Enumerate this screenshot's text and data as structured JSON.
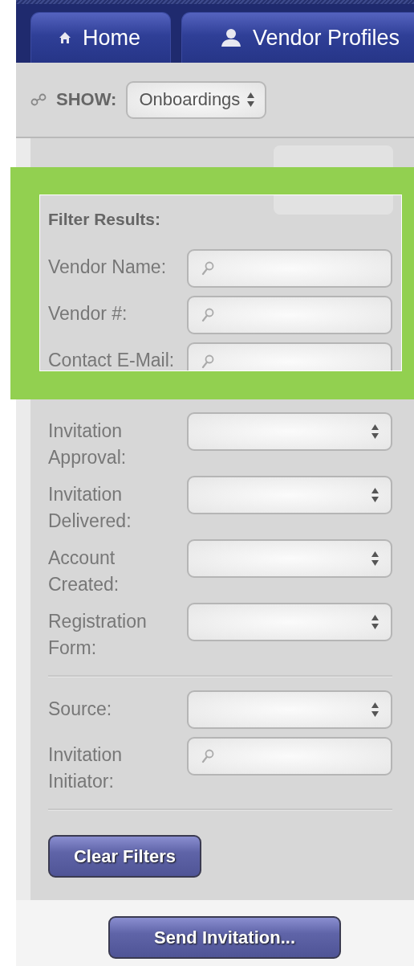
{
  "nav": {
    "tabs": [
      {
        "label": "Home",
        "selected": false
      },
      {
        "label": "Vendor Profiles",
        "selected": false
      }
    ]
  },
  "show": {
    "label": "SHOW:",
    "value": "Onboardings"
  },
  "filters": {
    "title": "Filter Results:",
    "groups": [
      [
        {
          "label": "Vendor Name:",
          "kind": "search"
        },
        {
          "label": "Vendor #:",
          "kind": "search"
        },
        {
          "label": "Contact E-Mail:",
          "kind": "search"
        }
      ],
      [
        {
          "label": "Invitation Approval:",
          "kind": "select"
        },
        {
          "label": "Invitation Delivered:",
          "kind": "select"
        },
        {
          "label": "Account Created:",
          "kind": "select"
        },
        {
          "label": "Registration Form:",
          "kind": "select"
        }
      ],
      [
        {
          "label": "Source:",
          "kind": "select"
        },
        {
          "label": "Invitation Initiator:",
          "kind": "search"
        }
      ]
    ],
    "clear_button": "Clear Filters"
  },
  "send_button": "Send Invitation..."
}
